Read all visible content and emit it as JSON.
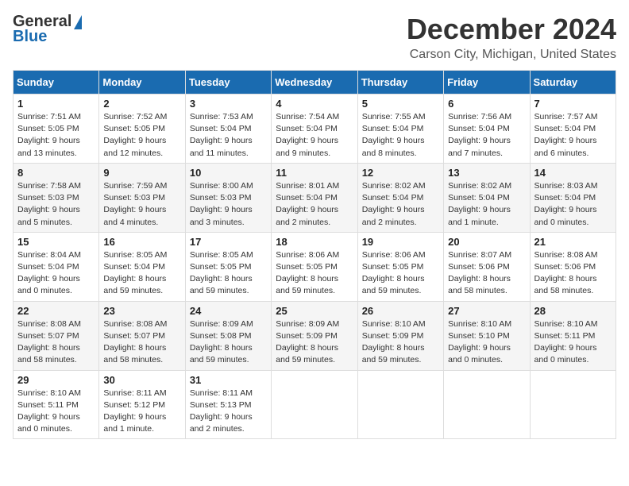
{
  "logo": {
    "line1": "General",
    "line2": "Blue"
  },
  "title": "December 2024",
  "location": "Carson City, Michigan, United States",
  "days_of_week": [
    "Sunday",
    "Monday",
    "Tuesday",
    "Wednesday",
    "Thursday",
    "Friday",
    "Saturday"
  ],
  "weeks": [
    [
      {
        "day": "1",
        "sunrise": "7:51 AM",
        "sunset": "5:05 PM",
        "daylight": "9 hours and 13 minutes."
      },
      {
        "day": "2",
        "sunrise": "7:52 AM",
        "sunset": "5:05 PM",
        "daylight": "9 hours and 12 minutes."
      },
      {
        "day": "3",
        "sunrise": "7:53 AM",
        "sunset": "5:04 PM",
        "daylight": "9 hours and 11 minutes."
      },
      {
        "day": "4",
        "sunrise": "7:54 AM",
        "sunset": "5:04 PM",
        "daylight": "9 hours and 9 minutes."
      },
      {
        "day": "5",
        "sunrise": "7:55 AM",
        "sunset": "5:04 PM",
        "daylight": "9 hours and 8 minutes."
      },
      {
        "day": "6",
        "sunrise": "7:56 AM",
        "sunset": "5:04 PM",
        "daylight": "9 hours and 7 minutes."
      },
      {
        "day": "7",
        "sunrise": "7:57 AM",
        "sunset": "5:04 PM",
        "daylight": "9 hours and 6 minutes."
      }
    ],
    [
      {
        "day": "8",
        "sunrise": "7:58 AM",
        "sunset": "5:03 PM",
        "daylight": "9 hours and 5 minutes."
      },
      {
        "day": "9",
        "sunrise": "7:59 AM",
        "sunset": "5:03 PM",
        "daylight": "9 hours and 4 minutes."
      },
      {
        "day": "10",
        "sunrise": "8:00 AM",
        "sunset": "5:03 PM",
        "daylight": "9 hours and 3 minutes."
      },
      {
        "day": "11",
        "sunrise": "8:01 AM",
        "sunset": "5:04 PM",
        "daylight": "9 hours and 2 minutes."
      },
      {
        "day": "12",
        "sunrise": "8:02 AM",
        "sunset": "5:04 PM",
        "daylight": "9 hours and 2 minutes."
      },
      {
        "day": "13",
        "sunrise": "8:02 AM",
        "sunset": "5:04 PM",
        "daylight": "9 hours and 1 minute."
      },
      {
        "day": "14",
        "sunrise": "8:03 AM",
        "sunset": "5:04 PM",
        "daylight": "9 hours and 0 minutes."
      }
    ],
    [
      {
        "day": "15",
        "sunrise": "8:04 AM",
        "sunset": "5:04 PM",
        "daylight": "9 hours and 0 minutes."
      },
      {
        "day": "16",
        "sunrise": "8:05 AM",
        "sunset": "5:04 PM",
        "daylight": "8 hours and 59 minutes."
      },
      {
        "day": "17",
        "sunrise": "8:05 AM",
        "sunset": "5:05 PM",
        "daylight": "8 hours and 59 minutes."
      },
      {
        "day": "18",
        "sunrise": "8:06 AM",
        "sunset": "5:05 PM",
        "daylight": "8 hours and 59 minutes."
      },
      {
        "day": "19",
        "sunrise": "8:06 AM",
        "sunset": "5:05 PM",
        "daylight": "8 hours and 59 minutes."
      },
      {
        "day": "20",
        "sunrise": "8:07 AM",
        "sunset": "5:06 PM",
        "daylight": "8 hours and 58 minutes."
      },
      {
        "day": "21",
        "sunrise": "8:08 AM",
        "sunset": "5:06 PM",
        "daylight": "8 hours and 58 minutes."
      }
    ],
    [
      {
        "day": "22",
        "sunrise": "8:08 AM",
        "sunset": "5:07 PM",
        "daylight": "8 hours and 58 minutes."
      },
      {
        "day": "23",
        "sunrise": "8:08 AM",
        "sunset": "5:07 PM",
        "daylight": "8 hours and 58 minutes."
      },
      {
        "day": "24",
        "sunrise": "8:09 AM",
        "sunset": "5:08 PM",
        "daylight": "8 hours and 59 minutes."
      },
      {
        "day": "25",
        "sunrise": "8:09 AM",
        "sunset": "5:09 PM",
        "daylight": "8 hours and 59 minutes."
      },
      {
        "day": "26",
        "sunrise": "8:10 AM",
        "sunset": "5:09 PM",
        "daylight": "8 hours and 59 minutes."
      },
      {
        "day": "27",
        "sunrise": "8:10 AM",
        "sunset": "5:10 PM",
        "daylight": "9 hours and 0 minutes."
      },
      {
        "day": "28",
        "sunrise": "8:10 AM",
        "sunset": "5:11 PM",
        "daylight": "9 hours and 0 minutes."
      }
    ],
    [
      {
        "day": "29",
        "sunrise": "8:10 AM",
        "sunset": "5:11 PM",
        "daylight": "9 hours and 0 minutes."
      },
      {
        "day": "30",
        "sunrise": "8:11 AM",
        "sunset": "5:12 PM",
        "daylight": "9 hours and 1 minute."
      },
      {
        "day": "31",
        "sunrise": "8:11 AM",
        "sunset": "5:13 PM",
        "daylight": "9 hours and 2 minutes."
      },
      null,
      null,
      null,
      null
    ]
  ]
}
